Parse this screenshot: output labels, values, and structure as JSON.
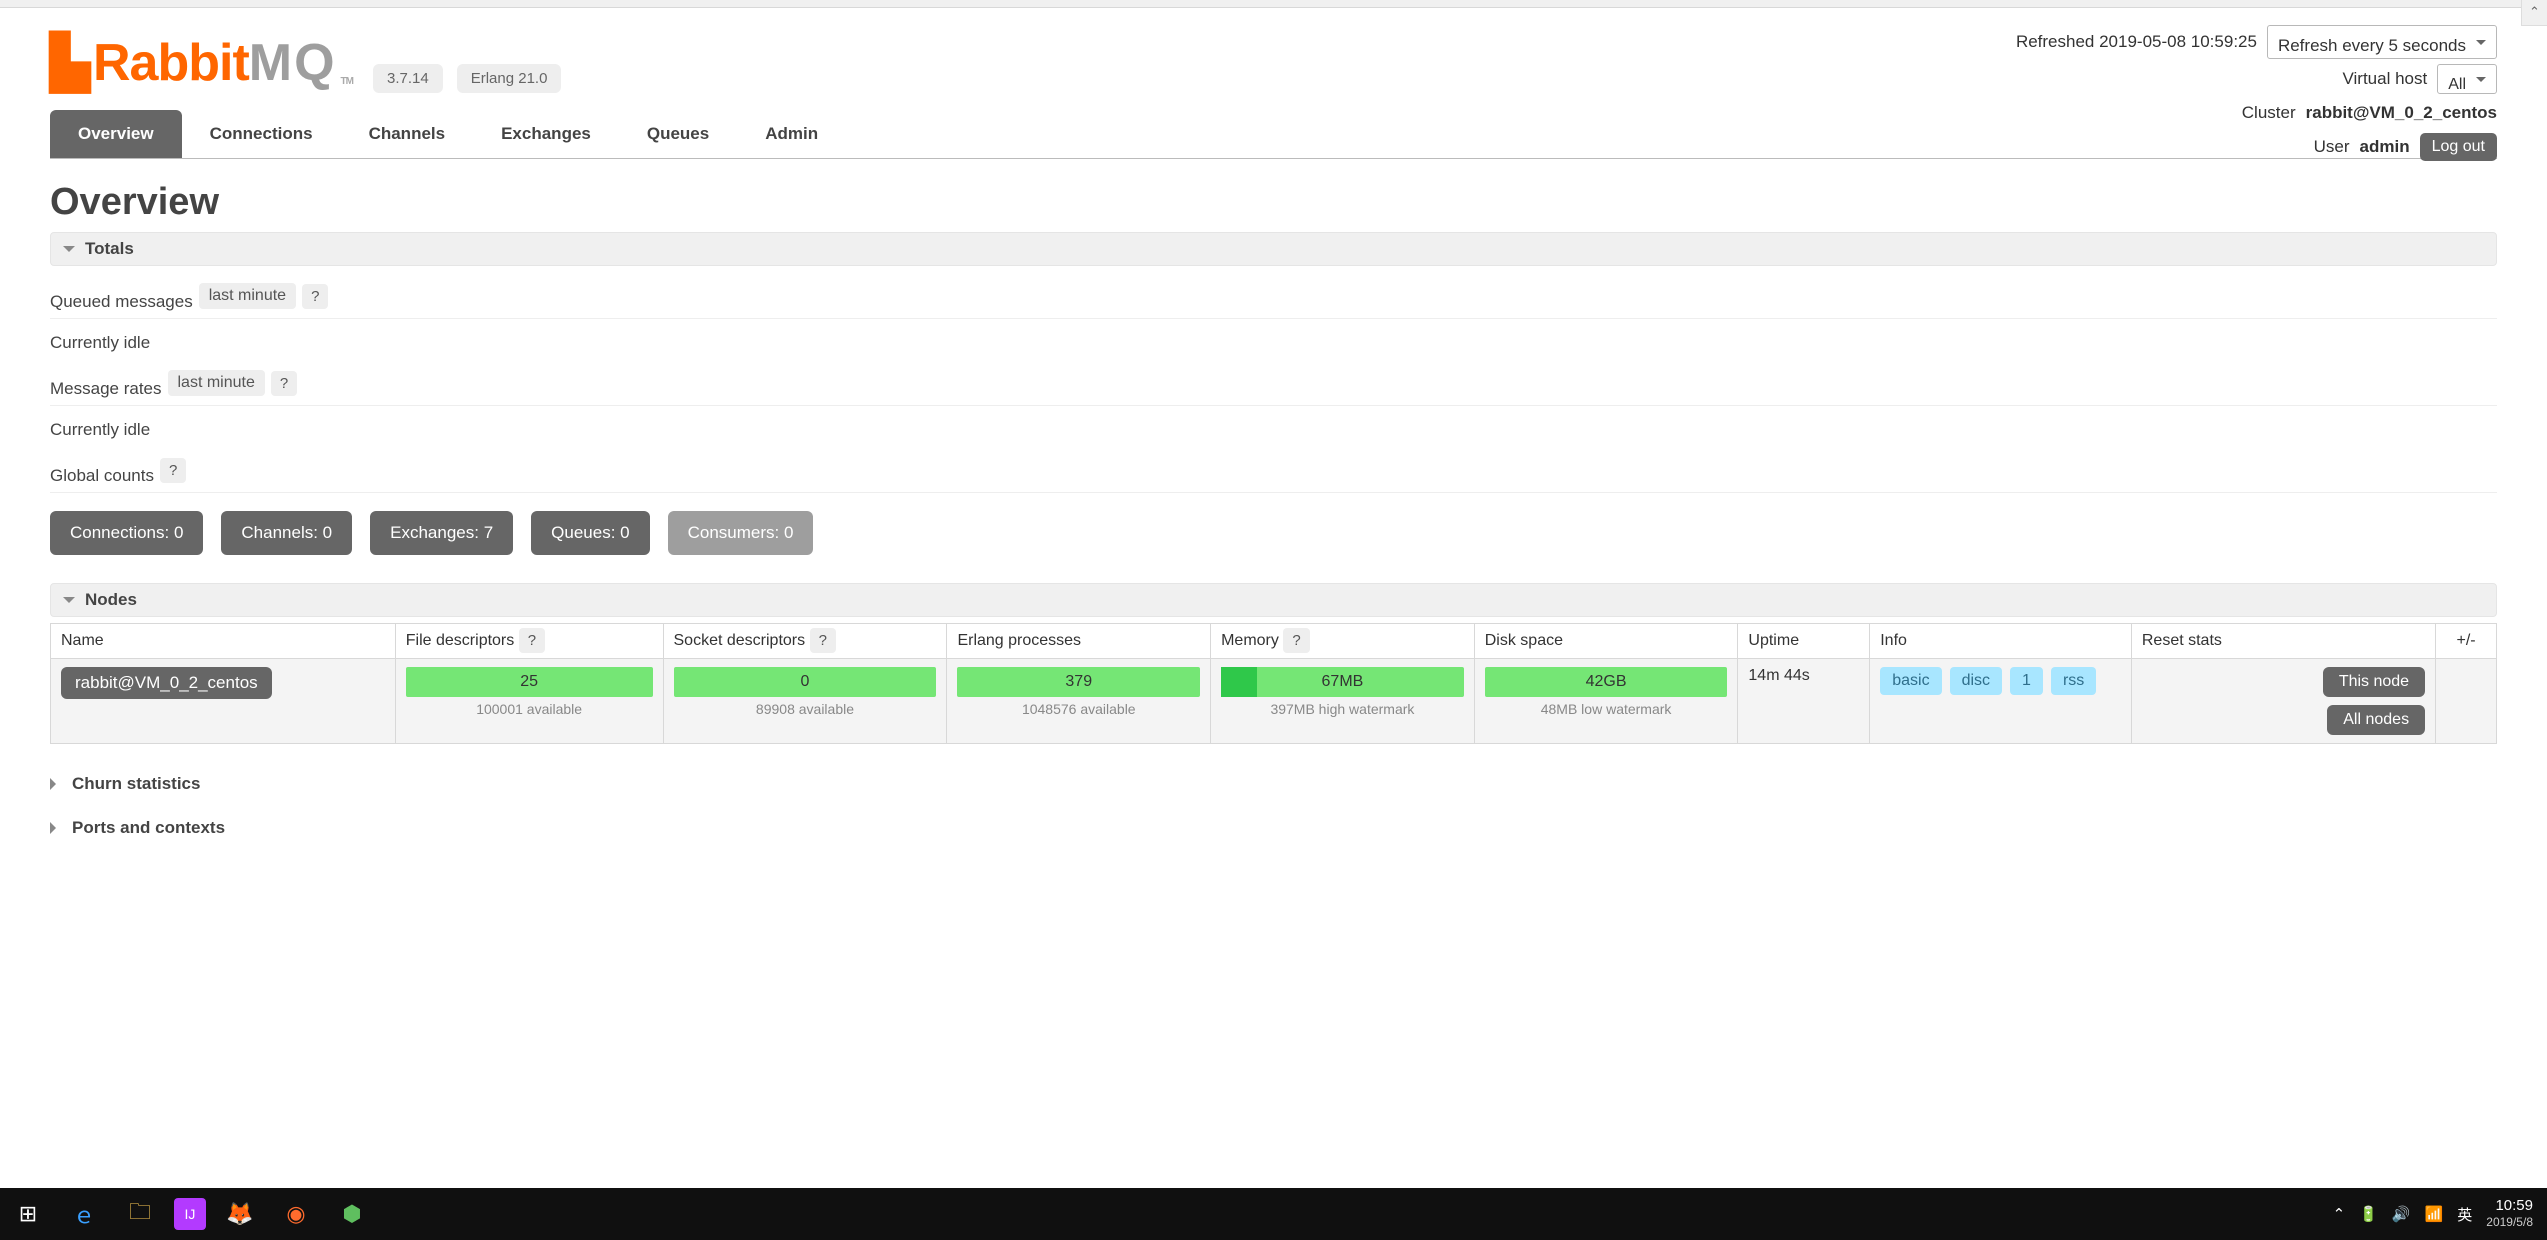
{
  "app": {
    "name_a": "Rabbit",
    "name_b": "MQ",
    "tm": "TM"
  },
  "versions": {
    "rmq": "3.7.14",
    "erlang": "Erlang 21.0"
  },
  "refresh": {
    "label": "Refreshed 2019-05-08 10:59:25",
    "interval": "Refresh every 5 seconds"
  },
  "vhost": {
    "label": "Virtual host",
    "value": "All"
  },
  "cluster": {
    "label": "Cluster",
    "value": "rabbit@VM_0_2_centos"
  },
  "user": {
    "label": "User",
    "value": "admin",
    "logout": "Log out"
  },
  "tabs": [
    "Overview",
    "Connections",
    "Channels",
    "Exchanges",
    "Queues",
    "Admin"
  ],
  "page_title": "Overview",
  "sections": {
    "totals": "Totals",
    "nodes": "Nodes",
    "churn": "Churn statistics",
    "ports": "Ports and contexts"
  },
  "totals": {
    "qm_label": "Queued messages",
    "qm_range": "last minute",
    "qm_idle": "Currently idle",
    "mr_label": "Message rates",
    "mr_range": "last minute",
    "mr_idle": "Currently idle",
    "gc_label": "Global counts",
    "help": "?"
  },
  "counts": [
    {
      "label": "Connections: 0"
    },
    {
      "label": "Channels: 0"
    },
    {
      "label": "Exchanges: 7"
    },
    {
      "label": "Queues: 0"
    },
    {
      "label": "Consumers: 0",
      "disabled": true
    }
  ],
  "nodes_table": {
    "headers": [
      "Name",
      "File descriptors",
      "Socket descriptors",
      "Erlang processes",
      "Memory",
      "Disk space",
      "Uptime",
      "Info",
      "Reset stats"
    ],
    "plus_minus": "+/-",
    "help": "?",
    "row": {
      "name": "rabbit@VM_0_2_centos",
      "fd": "25",
      "fd_sub": "100001 available",
      "sd": "0",
      "sd_sub": "89908 available",
      "ep": "379",
      "ep_sub": "1048576 available",
      "mem": "67MB",
      "mem_sub": "397MB high watermark",
      "ds": "42GB",
      "ds_sub": "48MB low watermark",
      "uptime": "14m 44s",
      "info": [
        "basic",
        "disc",
        "1",
        "rss"
      ],
      "reset_this": "This node",
      "reset_all": "All nodes"
    }
  },
  "taskbar": {
    "clock_time": "10:59",
    "clock_date": "2019/5/8",
    "ime": "英"
  }
}
